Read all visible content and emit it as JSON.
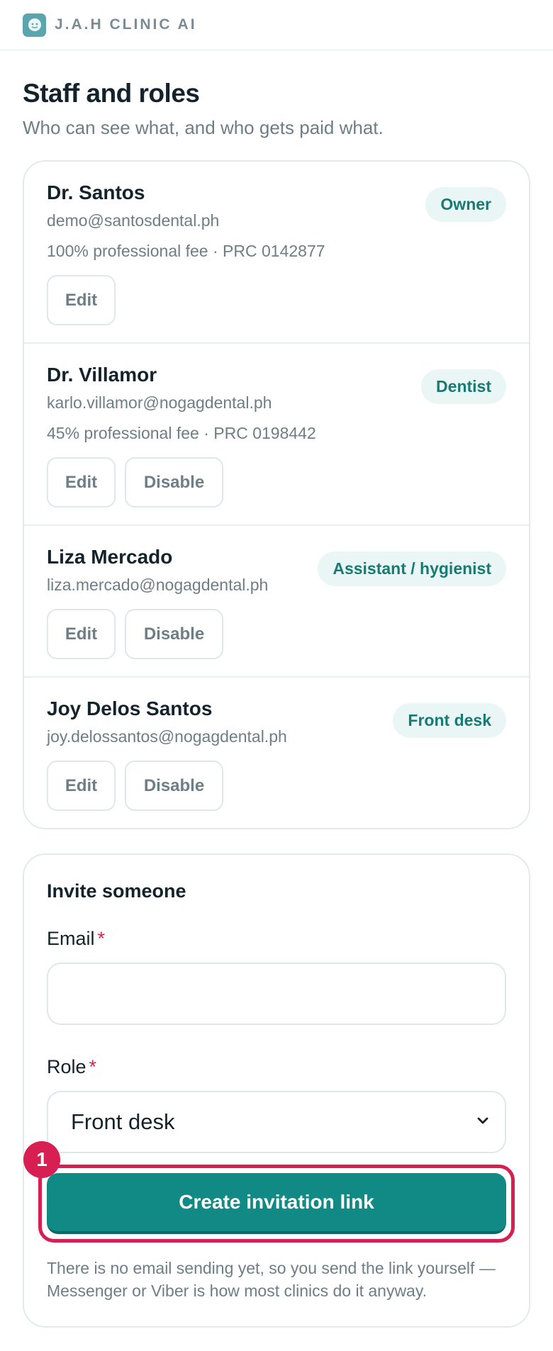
{
  "header": {
    "brand": "J.A.H CLINIC AI",
    "logo_icon": "tooth-face-icon"
  },
  "page": {
    "title": "Staff and roles",
    "subtitle": "Who can see what, and who gets paid what."
  },
  "staff": [
    {
      "name": "Dr. Santos",
      "email": "demo@santosdental.ph",
      "fee": "100% professional fee · PRC 0142877",
      "role": "Owner",
      "edit_label": "Edit"
    },
    {
      "name": "Dr. Villamor",
      "email": "karlo.villamor@nogagdental.ph",
      "fee": "45% professional fee · PRC 0198442",
      "role": "Dentist",
      "edit_label": "Edit",
      "disable_label": "Disable"
    },
    {
      "name": "Liza Mercado",
      "email": "liza.mercado@nogagdental.ph",
      "role": "Assistant / hygienist",
      "edit_label": "Edit",
      "disable_label": "Disable"
    },
    {
      "name": "Joy Delos Santos",
      "email": "joy.delossantos@nogagdental.ph",
      "role": "Front desk",
      "edit_label": "Edit",
      "disable_label": "Disable"
    }
  ],
  "invite": {
    "title": "Invite someone",
    "email_label": "Email",
    "email_value": "",
    "role_label": "Role",
    "required_mark": "*",
    "role_selected": "Front desk",
    "submit_label": "Create invitation link",
    "hint": "There is no email sending yet, so you send the link yourself — Messenger or Viber is how most clinics do it anyway."
  },
  "annotation": {
    "marker_number": "1"
  },
  "colors": {
    "accent": "#118a86",
    "badge_bg": "#e9f6f5",
    "badge_text": "#177a73",
    "highlight": "#d81f53"
  }
}
